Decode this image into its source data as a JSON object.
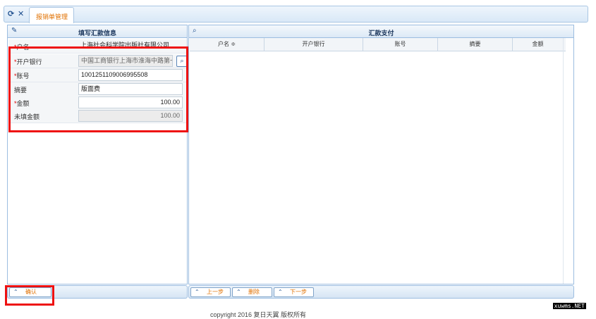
{
  "tabs": {
    "active_label": "报销单管理"
  },
  "left_panel": {
    "title": "填写汇款信息",
    "fields": [
      {
        "label": "户名",
        "required": true,
        "value": "上海社会科学院出版社有限公司"
      },
      {
        "label": "开户银行",
        "required": true,
        "value": "中国工商银行上海市淮海中路第一"
      },
      {
        "label": "账号",
        "required": true,
        "value": "1001251109006995508"
      },
      {
        "label": "摘要",
        "required": false,
        "value": "版面费"
      },
      {
        "label": "金额",
        "required": true,
        "value": "100.00"
      },
      {
        "label": "未填金额",
        "required": false,
        "value": "100.00"
      }
    ]
  },
  "right_panel": {
    "title": "汇款支付",
    "columns": [
      "户名 ≑",
      "开户银行",
      "账号",
      "摘要",
      "金额"
    ]
  },
  "footer": {
    "confirm_label": "确认",
    "prev_label": "上一步",
    "delete_label": "删除",
    "next_label": "下一步"
  },
  "copyright": "copyright 2016 复日天翼 版权所有",
  "watermark": "xuwms.NET",
  "colors": {
    "accent": "#e07000",
    "highlight": "#ee1111",
    "border": "#9cbde0"
  }
}
